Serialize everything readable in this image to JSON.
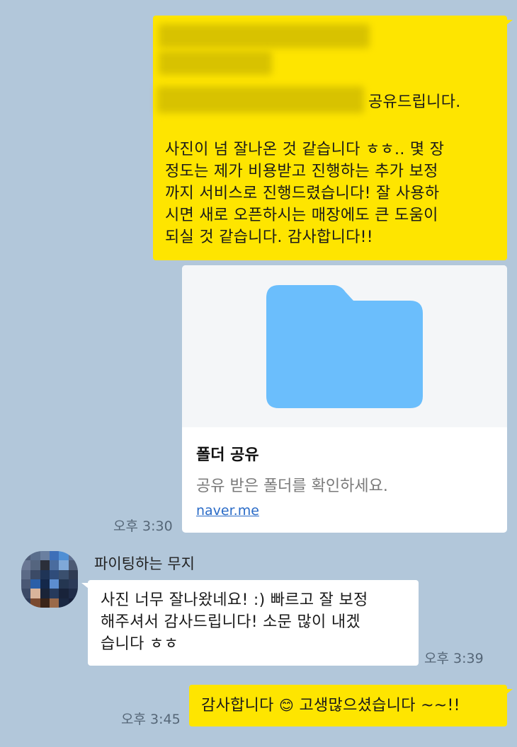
{
  "messages": {
    "first": {
      "line2_suffix": "공유드립니다.",
      "body": "사진이 넘 잘나온 것 같습니다 ㅎㅎ.. 몇 장\n정도는 제가 비용받고 진행하는 추가 보정\n까지 서비스로 진행드렸습니다! 잘 사용하\n시면 새로 오픈하시는 매장에도 큰 도움이\n되실 것 같습니다. 감사합니다!!",
      "background": "#fee500"
    },
    "folder_card": {
      "title": "폴더 공유",
      "description": "공유 받은 폴더를 확인하세요.",
      "link": "naver.me",
      "icon": "folder-icon",
      "icon_color": "#6bbefc",
      "time": "오후 3:30"
    },
    "reply": {
      "sender": "파이팅하는 무지",
      "text": "사진 너무 잘나왔네요! :) 빠르고 잘 보정\n해주셔서 감사드립니다! 소문 많이 내겠\n습니다 ㅎㅎ",
      "time": "오후 3:39",
      "avatar": "pixelated-avatar"
    },
    "last": {
      "text_before": "감사합니다",
      "emoji": "😊",
      "text_after": "고생많으셨습니다 ~~!!",
      "time": "오후 3:45"
    }
  },
  "colors": {
    "chat_background": "#b2c7da",
    "my_bubble": "#fee500",
    "other_bubble": "#ffffff",
    "link": "#2a6bc7"
  }
}
